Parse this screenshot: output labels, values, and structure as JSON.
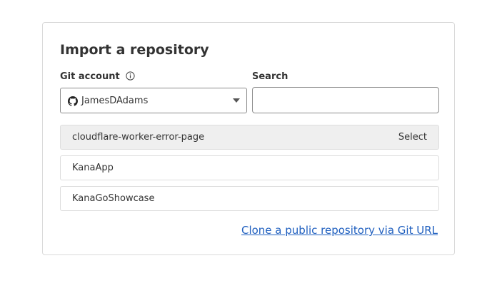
{
  "dialog": {
    "title": "Import a repository"
  },
  "git_account": {
    "label": "Git account",
    "info_icon": "info-icon",
    "provider_icon": "github-icon",
    "selected": "JamesDAdams"
  },
  "search": {
    "label": "Search",
    "value": "",
    "placeholder": ""
  },
  "repositories": [
    {
      "name": "cloudflare-worker-error-page",
      "action": "Select"
    },
    {
      "name": "KanaApp"
    },
    {
      "name": "KanaGoShowcase"
    }
  ],
  "clone_link": {
    "label": "Clone a public repository via Git URL"
  },
  "colors": {
    "link": "#1f5fbf",
    "hover_row": "#efefef",
    "border": "#8c8c8c"
  }
}
